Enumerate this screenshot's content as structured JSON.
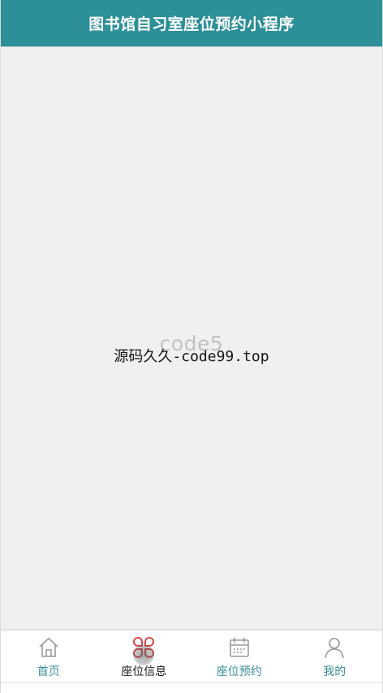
{
  "header": {
    "title": "图书馆自习室座位预约小程序"
  },
  "content": {
    "watermark_back": "code5",
    "watermark_front": "源码久久-code99.top"
  },
  "tabbar": {
    "items": [
      {
        "label": "首页",
        "icon": "home-icon",
        "active": false
      },
      {
        "label": "座位信息",
        "icon": "grid-icon",
        "active": true
      },
      {
        "label": "座位预约",
        "icon": "calendar-icon",
        "active": false
      },
      {
        "label": "我的",
        "icon": "user-icon",
        "active": false
      }
    ]
  },
  "colors": {
    "accent": "#2d8f98",
    "tab_label": "#3a8f97",
    "active_icon": "#d8474b",
    "inactive_icon": "#9a9a9a",
    "background": "#f0f0f0"
  }
}
